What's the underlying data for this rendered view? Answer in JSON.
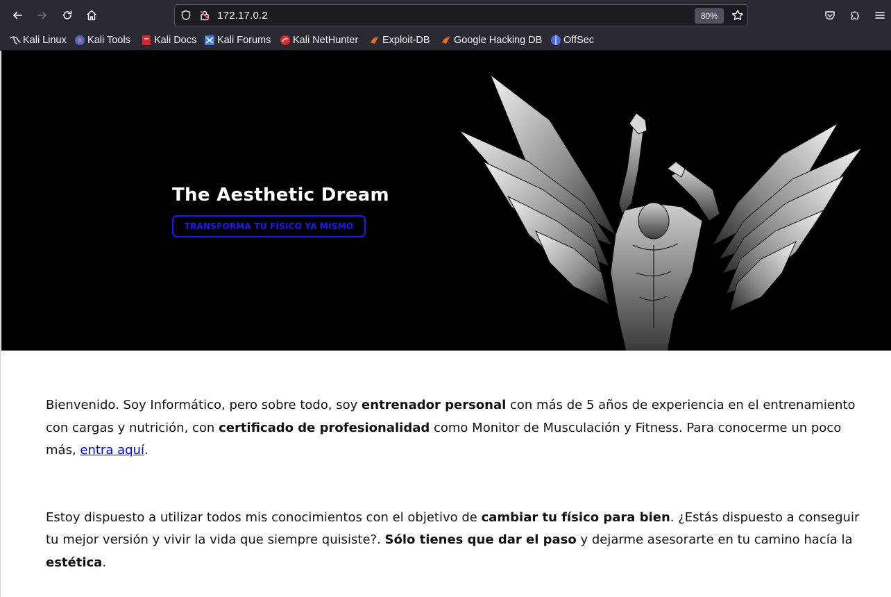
{
  "browser": {
    "url": "172.17.0.2",
    "zoom": "80%",
    "bookmarks": [
      {
        "label": "Kali Linux",
        "icon": "kali-dragon-icon"
      },
      {
        "label": "Kali Tools",
        "icon": "kali-tools-icon"
      },
      {
        "label": "Kali Docs",
        "icon": "kali-docs-icon"
      },
      {
        "label": "Kali Forums",
        "icon": "kali-forums-icon"
      },
      {
        "label": "Kali NetHunter",
        "icon": "kali-nethunter-icon"
      },
      {
        "label": "Exploit-DB",
        "icon": "exploit-db-icon"
      },
      {
        "label": "Google Hacking DB",
        "icon": "ghdb-icon"
      },
      {
        "label": "OffSec",
        "icon": "offsec-icon"
      }
    ],
    "colors": {
      "chrome": "#2b2a33",
      "urlbar": "#1c1b22",
      "text": "#fbfbfe"
    }
  },
  "hero": {
    "title": "The Aesthetic Dream",
    "cta_label": "TRANSFORMA TU FÍSICO YA MISMO",
    "colors": {
      "background": "#000000",
      "cta": "#1a1aff"
    }
  },
  "intro": {
    "p1_a": "Bienvenido. Soy Informático, pero sobre todo, soy ",
    "p1_b": "entrenador personal",
    "p1_c": " con más de 5 años de experiencia en el entrenamiento con cargas y nutrición, con ",
    "p1_d": "certificado de profesionalidad",
    "p1_e": " como Monitor de Musculación y Fitness. Para conocerme un poco más, ",
    "p1_link": "entra aquí",
    "p1_f": ".",
    "p2_a": "Estoy dispuesto a utilizar todos mis conocimientos con el objetivo de ",
    "p2_b": "cambiar tu físico para bien",
    "p2_c": ". ¿Estás dispuesto a conseguir tu mejor versión y vivir la vida que siempre quisiste?. ",
    "p2_d": "Sólo tienes que dar el paso",
    "p2_e": " y dejarme asesorarte en tu camino hacía la ",
    "p2_f": "estética",
    "p2_g": "."
  }
}
